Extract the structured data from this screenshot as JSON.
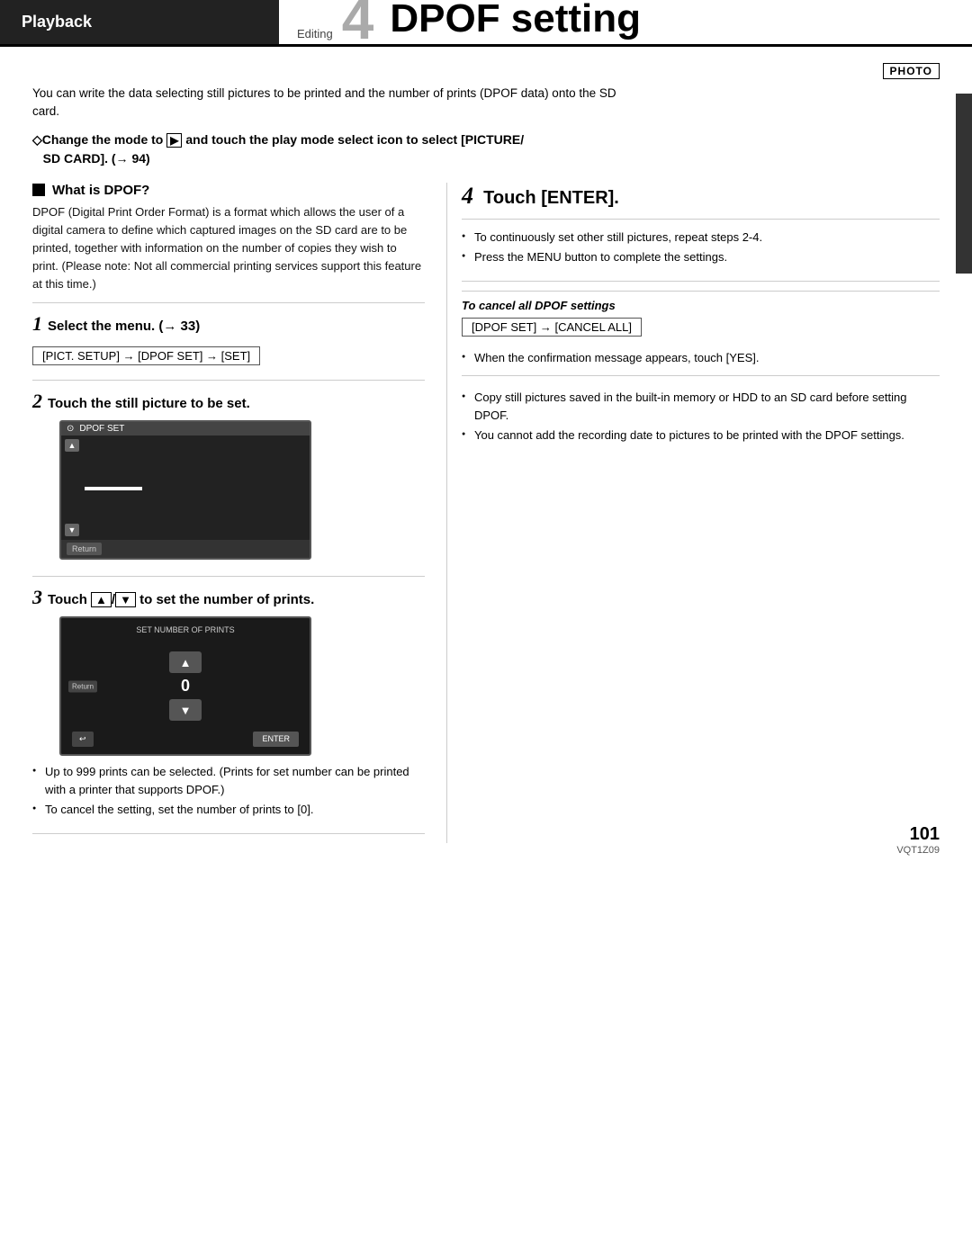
{
  "header": {
    "tab_label": "Playback",
    "editing_label": "Editing",
    "chapter_number": "4",
    "page_title": "DPOF setting"
  },
  "photo_badge": "PHOTO",
  "intro": {
    "text": "You can write the data selecting still pictures to be printed and the number of prints (DPOF data) onto the SD card."
  },
  "mode_instruction": {
    "diamond": "◇",
    "text": "Change the mode to",
    "play_icon": "▶",
    "text2": "and touch the play mode select icon to select [PICTURE/ SD CARD]. (→ 94)"
  },
  "what_is_dpof": {
    "heading": "What is DPOF?",
    "body": "DPOF (Digital Print Order Format) is a format which allows the user of a digital camera to define which captured images on the SD card are to be printed, together with information on the number of copies they wish to print. (Please note: Not all commercial printing services support this feature at this time.)"
  },
  "step1": {
    "num": "1",
    "heading": "Select the menu. (→ 33)",
    "menu_path": "[PICT. SETUP] → [DPOF SET] → [SET]"
  },
  "step2": {
    "num": "2",
    "heading": "Touch the still picture to be set.",
    "screen": {
      "title": "DPOF SET",
      "return_label": "Return"
    }
  },
  "step3": {
    "num": "3",
    "heading": "Touch",
    "heading2": "/",
    "heading3": "to set the number of prints.",
    "screen": {
      "title": "SET NUMBER OF PRINTS",
      "number": "0",
      "enter_label": "ENTER",
      "back_label": "↩",
      "return_label": "Return"
    },
    "bullets": [
      "Up to 999 prints can be selected. (Prints for set number can be printed with a printer that supports DPOF.)",
      "To cancel the setting, set the number of prints to [0]."
    ]
  },
  "step4": {
    "num": "4",
    "heading": "Touch [ENTER].",
    "bullets": [
      "To continuously set other still pictures, repeat steps 2-4.",
      "Press the MENU button to complete the settings."
    ]
  },
  "cancel_section": {
    "heading": "To cancel all DPOF settings",
    "path": "[DPOF SET] → [CANCEL ALL]",
    "bullet": "When the confirmation message appears, touch [YES]."
  },
  "notes": {
    "bullets": [
      "Copy still pictures saved in the built-in memory or HDD to an SD card before setting DPOF.",
      "You cannot add the recording date to pictures to be printed with the DPOF settings."
    ]
  },
  "footer": {
    "page_number": "101",
    "doc_code": "VQT1Z09"
  }
}
